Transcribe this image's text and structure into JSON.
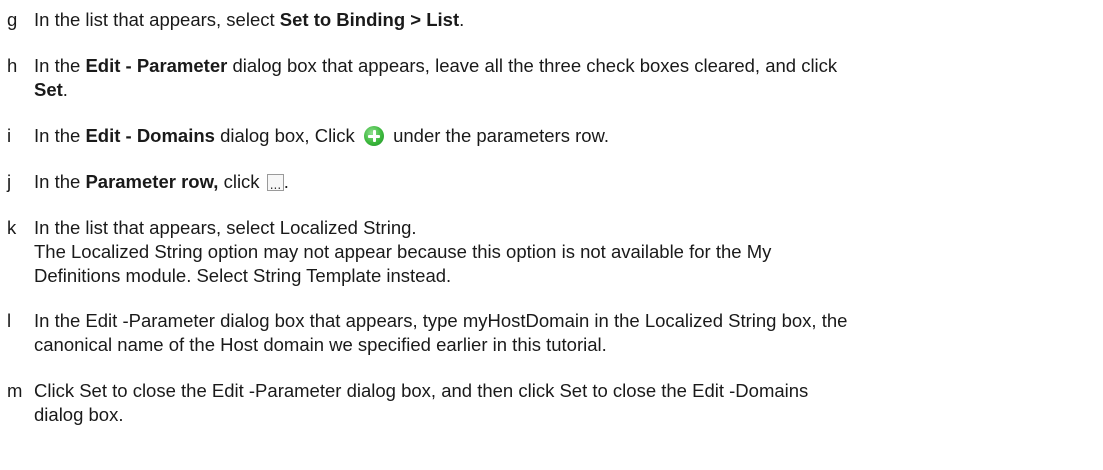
{
  "steps": [
    {
      "letter": "g",
      "lines": [
        [
          {
            "t": "In the list that appears, select "
          },
          {
            "t": "Set to Binding > List",
            "b": true
          },
          {
            "t": "."
          }
        ]
      ]
    },
    {
      "letter": "h",
      "lines": [
        [
          {
            "t": "In the "
          },
          {
            "t": "Edit - Parameter",
            "b": true
          },
          {
            "t": " dialog box that appears, leave all the three check boxes cleared, and click"
          }
        ],
        [
          {
            "t": "Set",
            "b": true
          },
          {
            "t": "."
          }
        ]
      ]
    },
    {
      "letter": "i",
      "lines": [
        [
          {
            "t": "In the "
          },
          {
            "t": "Edit - Domains",
            "b": true
          },
          {
            "t": " dialog box, Click "
          },
          {
            "icon": "add-green-circle-icon"
          },
          {
            "t": " under the parameters row."
          }
        ]
      ]
    },
    {
      "letter": "j",
      "lines": [
        [
          {
            "t": "In the "
          },
          {
            "t": "Parameter row,",
            "b": true
          },
          {
            "t": " click "
          },
          {
            "icon": "ellipsis-button-icon"
          },
          {
            "t": "."
          }
        ]
      ]
    },
    {
      "letter": "k",
      "lines": [
        [
          {
            "t": "In the list that appears, select Localized String."
          }
        ],
        [
          {
            "t": "The Localized String option may not appear because this option is not available for the My"
          }
        ],
        [
          {
            "t": "Definitions module. Select String Template instead."
          }
        ]
      ]
    },
    {
      "letter": "l",
      "lines": [
        [
          {
            "t": "In the Edit -Parameter dialog box that appears, type myHostDomain in the Localized String box, the"
          }
        ],
        [
          {
            "t": "canonical name of the Host domain we specified earlier in this tutorial."
          }
        ]
      ]
    },
    {
      "letter": "m",
      "lines": [
        [
          {
            "t": "Click Set to close the Edit -Parameter dialog box, and then click Set to close the Edit -Domains"
          }
        ],
        [
          {
            "t": "dialog box."
          }
        ]
      ]
    }
  ]
}
